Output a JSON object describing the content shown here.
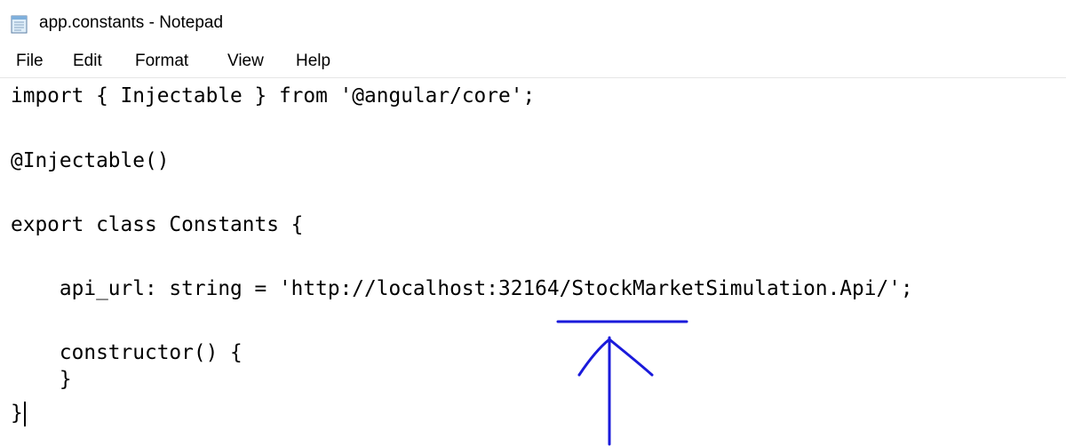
{
  "window": {
    "title": "app.constants - Notepad",
    "icon": "notepad-icon"
  },
  "menubar": {
    "items": [
      "File",
      "Edit",
      "Format",
      "View",
      "Help"
    ]
  },
  "editor": {
    "lines": [
      "import { Injectable } from '@angular/core';",
      "",
      "@Injectable()",
      "",
      "export class Constants {",
      "",
      "    api_url: string = 'http://localhost:32164/StockMarketSimulation.Api/';",
      "",
      "    constructor() {",
      "    }",
      "}"
    ]
  },
  "annotation": {
    "color": "#1a1adb",
    "shapes": [
      "underline-mark",
      "up-arrow-mark"
    ]
  }
}
